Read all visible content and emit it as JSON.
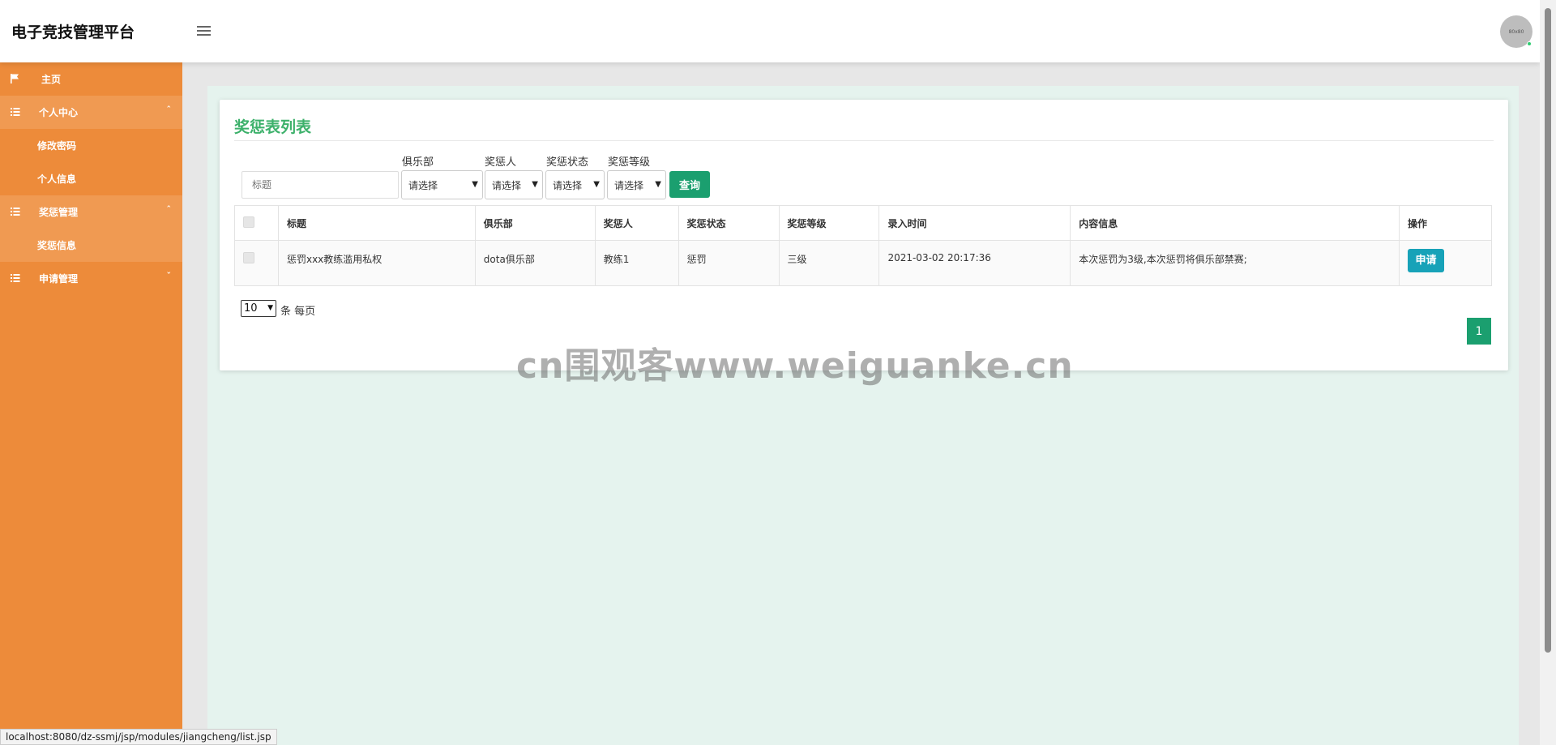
{
  "header": {
    "brand": "电子竞技管理平台",
    "avatar_text": "80x80"
  },
  "sidebar": {
    "home": "主页",
    "groups": [
      {
        "label": "个人中心",
        "items": [
          "修改密码",
          "个人信息"
        ]
      },
      {
        "label": "奖惩管理",
        "items": [
          "奖惩信息"
        ]
      },
      {
        "label": "申请管理",
        "items": []
      }
    ]
  },
  "card": {
    "title": "奖惩表列表",
    "search_placeholder": "标题",
    "filters": [
      {
        "label": "俱乐部",
        "value": "请选择"
      },
      {
        "label": "奖惩人",
        "value": "请选择"
      },
      {
        "label": "奖惩状态",
        "value": "请选择"
      },
      {
        "label": "奖惩等级",
        "value": "请选择"
      }
    ],
    "query_button": "查询"
  },
  "table": {
    "headers": [
      "标题",
      "俱乐部",
      "奖惩人",
      "奖惩状态",
      "奖惩等级",
      "录入时间",
      "内容信息",
      "操作"
    ],
    "rows": [
      {
        "title": "惩罚xxx教练滥用私权",
        "club": "dota俱乐部",
        "person": "教练1",
        "status": "惩罚",
        "level": "三级",
        "time": "2021-03-02 20:17:36",
        "content": "本次惩罚为3级,本次惩罚将俱乐部禁赛;",
        "action": "申请"
      }
    ]
  },
  "pagination": {
    "page_size": "10",
    "page_size_label": "条 每页",
    "current_page": "1"
  },
  "watermark": "cn围观客www.weiguanke.cn",
  "status_url": "localhost:8080/dz-ssmj/jsp/modules/jiangcheng/list.jsp",
  "colors": {
    "sidebar": "#ed8b3a",
    "accent_green": "#1b9f6f",
    "title_green": "#3db16b",
    "apply_blue": "#17a2b8"
  }
}
